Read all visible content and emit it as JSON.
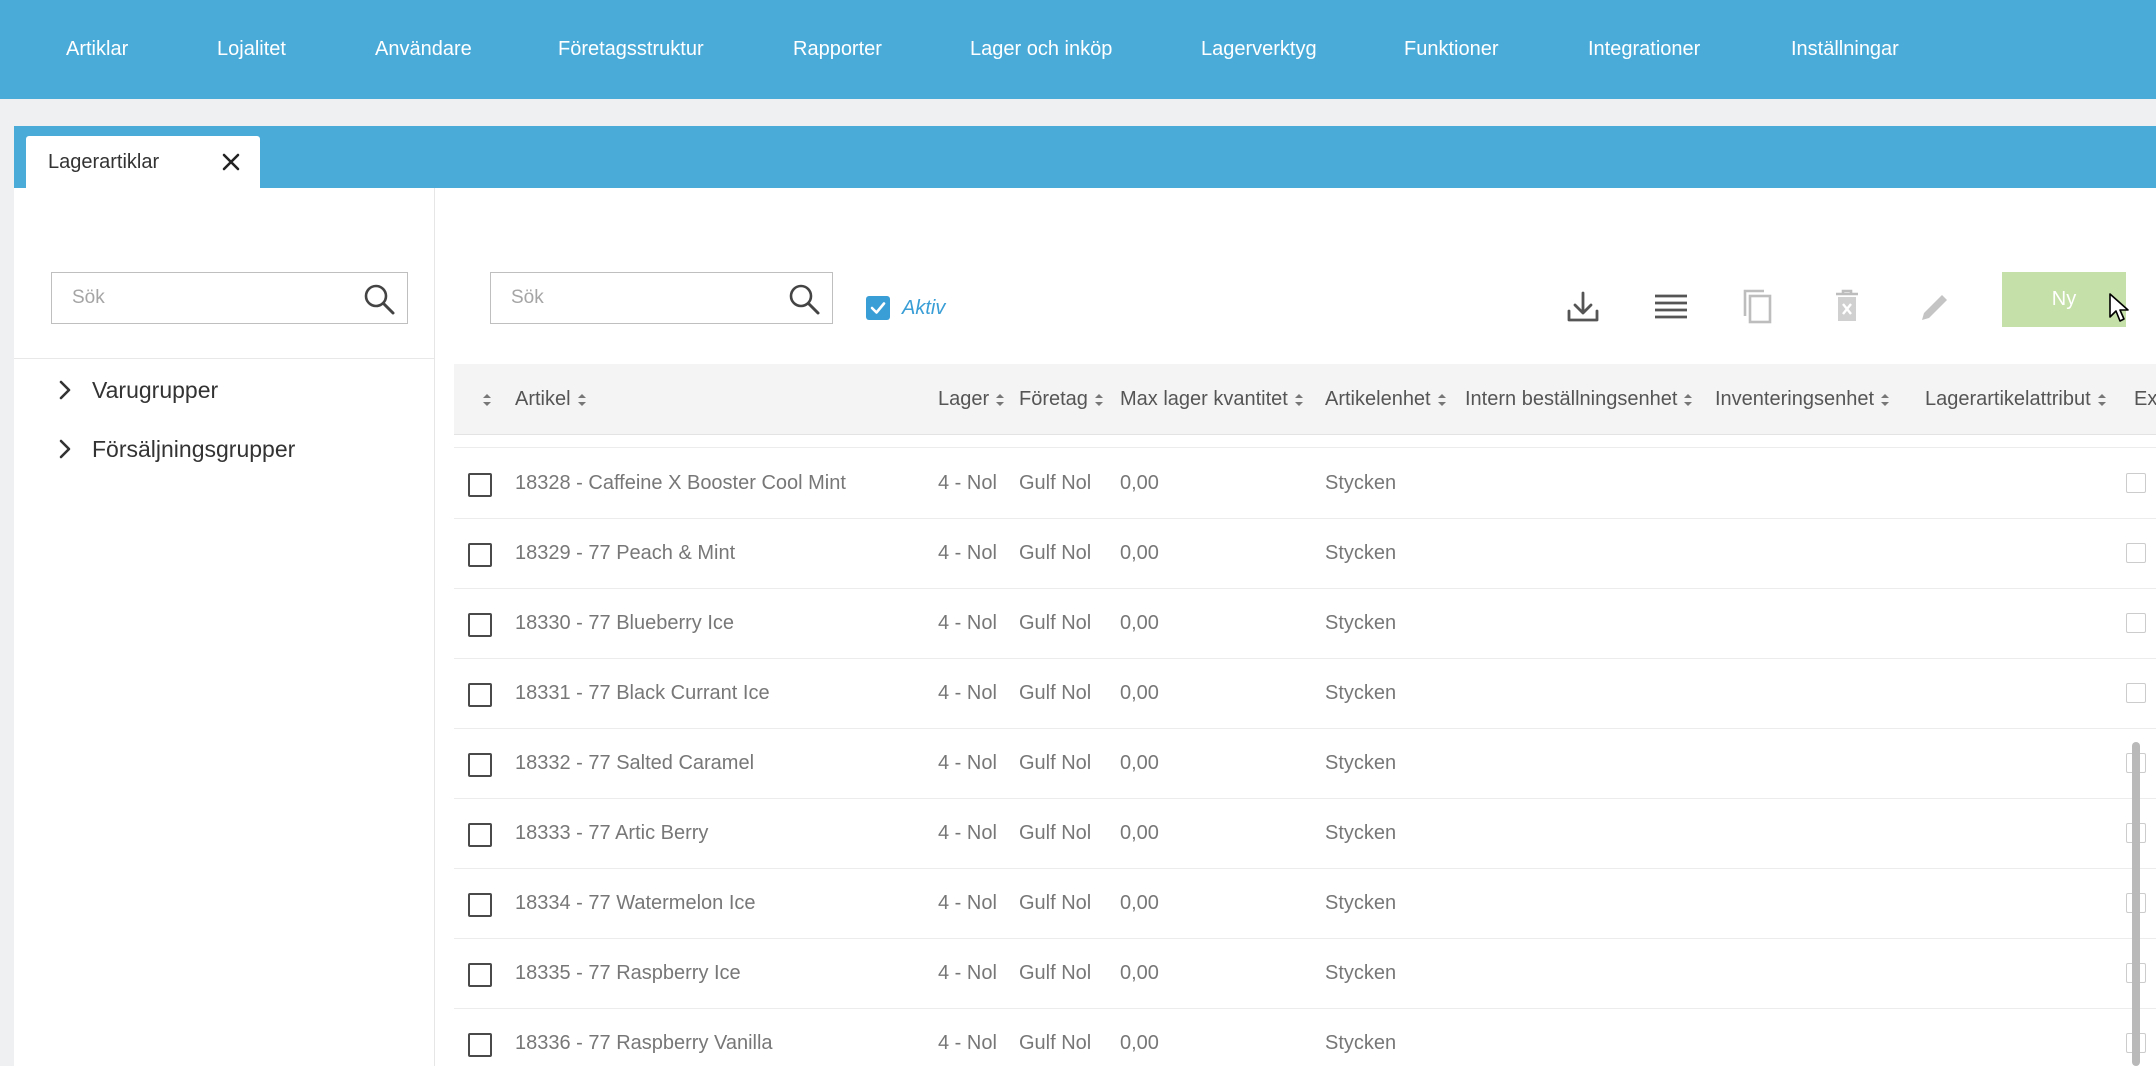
{
  "nav": {
    "items": [
      {
        "label": "Artiklar"
      },
      {
        "label": "Lojalitet"
      },
      {
        "label": "Användare"
      },
      {
        "label": "Företagsstruktur"
      },
      {
        "label": "Rapporter"
      },
      {
        "label": "Lager och inköp"
      },
      {
        "label": "Lagerverktyg"
      },
      {
        "label": "Funktioner"
      },
      {
        "label": "Integrationer"
      },
      {
        "label": "Inställningar"
      }
    ]
  },
  "tab": {
    "label": "Lagerartiklar"
  },
  "sidebar": {
    "search_placeholder": "Sök",
    "tree": [
      {
        "label": "Varugrupper"
      },
      {
        "label": "Försäljningsgrupper"
      }
    ]
  },
  "toolbar": {
    "search_placeholder": "Sök",
    "aktiv_label": "Aktiv",
    "aktiv_checked": true,
    "new_label": "Ny",
    "icons": [
      "download-icon",
      "list-icon",
      "copy-icon",
      "delete-icon",
      "edit-icon"
    ]
  },
  "grid": {
    "columns": [
      {
        "label": "Artikel"
      },
      {
        "label": "Lager"
      },
      {
        "label": "Företag"
      },
      {
        "label": "Max lager kvantitet"
      },
      {
        "label": "Artikelenhet"
      },
      {
        "label": "Intern beställningsenhet"
      },
      {
        "label": "Inventeringsenhet"
      },
      {
        "label": "Lagerartikelattribut"
      },
      {
        "label": "Ex"
      }
    ],
    "rows": [
      {
        "artikel": "18328 - Caffeine X Booster Cool Mint",
        "lager": "4 - Nol",
        "foretag": "Gulf Nol",
        "max": "0,00",
        "enhet": "Stycken"
      },
      {
        "artikel": "18329 - 77 Peach & Mint",
        "lager": "4 - Nol",
        "foretag": "Gulf Nol",
        "max": "0,00",
        "enhet": "Stycken"
      },
      {
        "artikel": "18330 - 77 Blueberry Ice",
        "lager": "4 - Nol",
        "foretag": "Gulf Nol",
        "max": "0,00",
        "enhet": "Stycken"
      },
      {
        "artikel": "18331 - 77 Black Currant Ice",
        "lager": "4 - Nol",
        "foretag": "Gulf Nol",
        "max": "0,00",
        "enhet": "Stycken"
      },
      {
        "artikel": "18332 - 77 Salted Caramel",
        "lager": "4 - Nol",
        "foretag": "Gulf Nol",
        "max": "0,00",
        "enhet": "Stycken"
      },
      {
        "artikel": "18333 - 77 Artic Berry",
        "lager": "4 - Nol",
        "foretag": "Gulf Nol",
        "max": "0,00",
        "enhet": "Stycken"
      },
      {
        "artikel": "18334 - 77 Watermelon Ice",
        "lager": "4 - Nol",
        "foretag": "Gulf Nol",
        "max": "0,00",
        "enhet": "Stycken"
      },
      {
        "artikel": "18335 - 77 Raspberry Ice",
        "lager": "4 - Nol",
        "foretag": "Gulf Nol",
        "max": "0,00",
        "enhet": "Stycken"
      },
      {
        "artikel": "18336 - 77 Raspberry Vanilla",
        "lager": "4 - Nol",
        "foretag": "Gulf Nol",
        "max": "0,00",
        "enhet": "Stycken"
      }
    ]
  },
  "colors": {
    "accent": "#4aabd9",
    "new_button": "#c5e0a8",
    "checkbox": "#3a9ed6"
  }
}
